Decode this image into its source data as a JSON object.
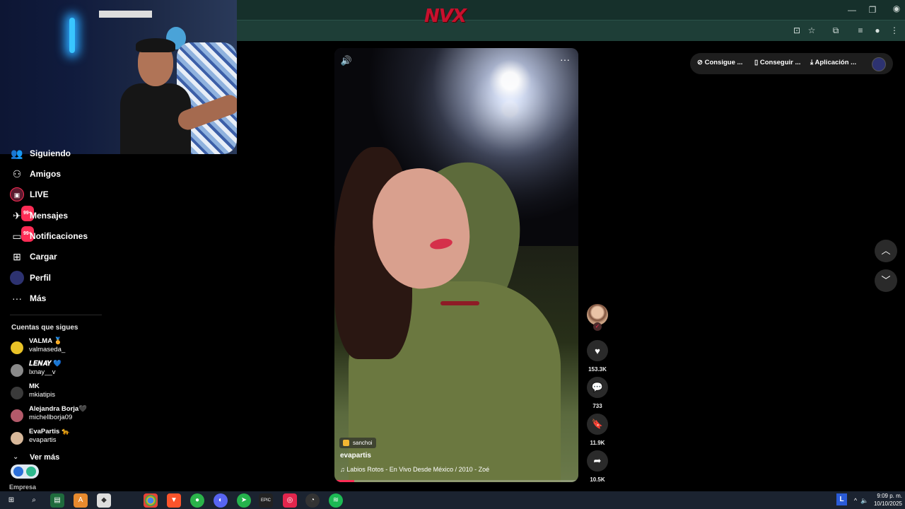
{
  "browser": {
    "logo_text": "NVX",
    "window_controls": [
      "—",
      "❐",
      "✕"
    ],
    "toolbar_icons": [
      "install-icon",
      "star-icon",
      "extensions-icon",
      "media-icon",
      "profile-icon",
      "menu-icon"
    ]
  },
  "sidebar": {
    "items": [
      {
        "label": "Siguiendo",
        "icon": "following-icon"
      },
      {
        "label": "Amigos",
        "icon": "friends-icon"
      },
      {
        "label": "LIVE",
        "icon": "live-icon"
      },
      {
        "label": "Mensajes",
        "icon": "messages-icon",
        "badge": "99+"
      },
      {
        "label": "Notificaciones",
        "icon": "notifications-icon",
        "badge": "99+"
      },
      {
        "label": "Cargar",
        "icon": "upload-icon"
      },
      {
        "label": "Perfil",
        "icon": "profile-icon"
      },
      {
        "label": "Más",
        "icon": "more-icon"
      }
    ],
    "following_title": "Cuentas que sigues",
    "accounts": [
      {
        "name": "VALMA 🏅",
        "handle": "valmaseda_"
      },
      {
        "name": "𝑳𝑬𝑵𝑨𝒀 💙",
        "handle": "lxnay__v"
      },
      {
        "name": "MK",
        "handle": "mkiatipis"
      },
      {
        "name": "Alejandra Borja🖤",
        "handle": "michellborja09"
      },
      {
        "name": "EvaPartis 🐆",
        "handle": "evapartis"
      }
    ],
    "see_more": "Ver más",
    "footer": "Empresa"
  },
  "video": {
    "effect_label": "sanchoi",
    "author": "evapartis",
    "music": "♫ Labios Rotos - En Vivo Desde México / 2010 - Zoé",
    "progress": 0.08
  },
  "actions": {
    "likes": "153.3K",
    "comments": "733",
    "saves": "11.9K",
    "shares": "10.5K"
  },
  "top_bar": {
    "coins": "Consigue ...",
    "get_app": "Conseguir ...",
    "app": "Aplicación ..."
  },
  "taskbar": {
    "lang": "L",
    "time": "9:09 p. m.",
    "date": "10/10/2025"
  }
}
